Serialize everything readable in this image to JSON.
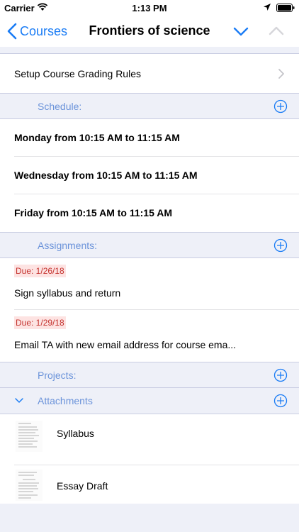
{
  "status_bar": {
    "carrier": "Carrier",
    "time": "1:13 PM"
  },
  "nav": {
    "back_label": "Courses",
    "title": "Frontiers of science"
  },
  "setup_row": {
    "label": "Setup Course Grading Rules"
  },
  "schedule": {
    "header": "Schedule:",
    "items": [
      "Monday from 10:15 AM to 11:15 AM",
      "Wednesday from 10:15 AM to 11:15 AM",
      "Friday from 10:15 AM to 11:15 AM"
    ]
  },
  "assignments": {
    "header": "Assignments:",
    "items": [
      {
        "due": "Due: 1/26/18",
        "title": "Sign syllabus and return"
      },
      {
        "due": "Due: 1/29/18",
        "title": "Email TA with new email address for course ema..."
      }
    ]
  },
  "projects": {
    "header": "Projects:"
  },
  "attachments": {
    "header": "Attachments",
    "items": [
      {
        "name": "Syllabus"
      },
      {
        "name": "Essay Draft"
      }
    ]
  },
  "colors": {
    "accent": "#1a7cf5",
    "section_label": "#6b93da",
    "due_text": "#c4322e",
    "due_bg": "#fde3e2",
    "section_bg": "#eef0f8"
  },
  "icons": {
    "back": "chevron-left-icon",
    "down": "chevron-down-icon",
    "up": "chevron-up-icon",
    "add": "plus-circle-icon",
    "disclosure": "chevron-right-icon"
  }
}
